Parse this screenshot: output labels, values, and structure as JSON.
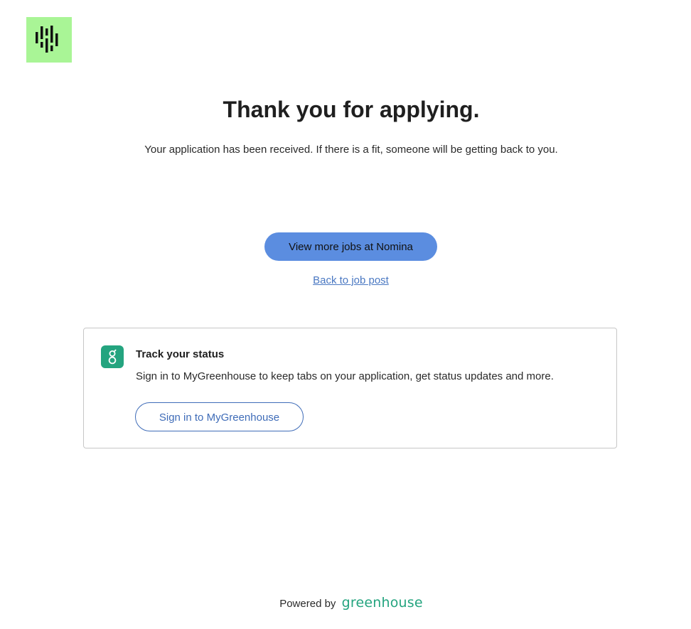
{
  "header": {
    "logo_icon": "company-logo-icon",
    "logo_color": "#a9f596"
  },
  "confirmation": {
    "title": "Thank you for applying.",
    "message": "Your application has been received. If there is a fit, someone will be getting back to you."
  },
  "actions": {
    "view_jobs_label": "View more jobs at Nomina",
    "back_link_label": "Back to job post",
    "primary_color": "#5b8de0"
  },
  "status_card": {
    "icon": "greenhouse-g-icon",
    "title": "Track your status",
    "text": "Sign in to MyGreenhouse to keep tabs on your application, get status updates and more.",
    "signin_label": "Sign in to MyGreenhouse"
  },
  "footer": {
    "powered_by": "Powered by",
    "brand": "greenhouse",
    "brand_color": "#24a47f"
  }
}
